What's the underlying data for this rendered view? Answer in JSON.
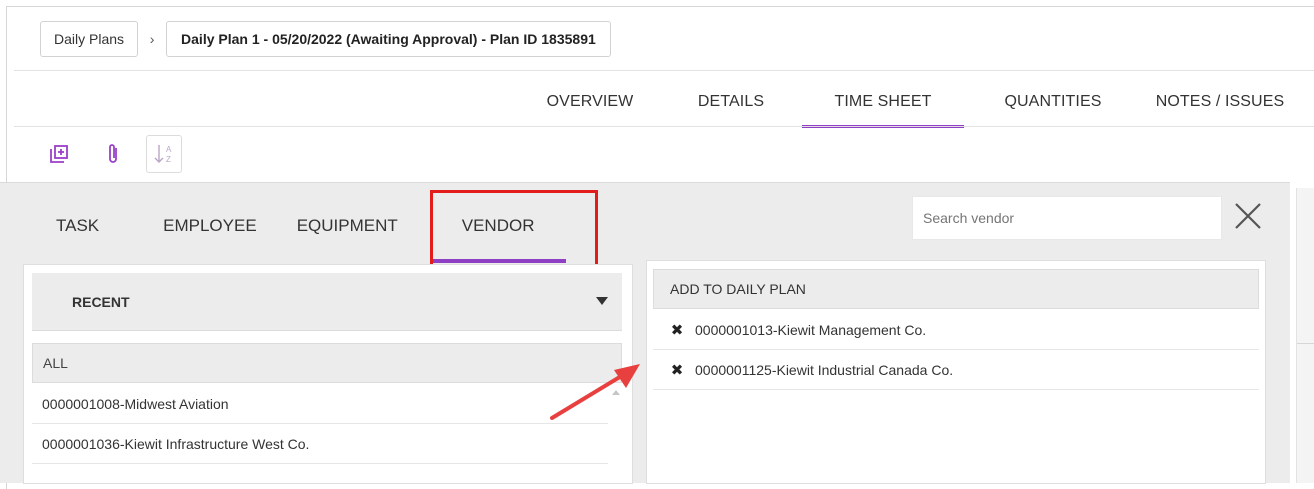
{
  "breadcrumb": {
    "root": "Daily Plans",
    "separator": "›",
    "current": "Daily Plan 1 - 05/20/2022 (Awaiting Approval) - Plan ID 1835891"
  },
  "top_tabs": [
    {
      "label": "OVERVIEW",
      "active": false
    },
    {
      "label": "DETAILS",
      "active": false
    },
    {
      "label": "TIME SHEET",
      "active": true
    },
    {
      "label": "QUANTITIES",
      "active": false
    },
    {
      "label": "NOTES / ISSUES",
      "active": false
    }
  ],
  "toolbar": {
    "icons": [
      "copy-add-icon",
      "paperclip-icon",
      "sort-az-icon"
    ],
    "accent": "#9b3fc8"
  },
  "resource_tabs": [
    {
      "label": "TASK",
      "active": false
    },
    {
      "label": "EMPLOYEE",
      "active": false
    },
    {
      "label": "EQUIPMENT",
      "active": false
    },
    {
      "label": "VENDOR",
      "active": true
    }
  ],
  "search": {
    "placeholder": "Search vendor"
  },
  "left_list": {
    "recent_label": "RECENT",
    "all_label": "ALL",
    "items": [
      "0000001008-Midwest Aviation",
      "0000001036-Kiewit Infrastructure West Co."
    ]
  },
  "right_list": {
    "header": "ADD TO DAILY PLAN",
    "items": [
      "0000001013-Kiewit Management Co.",
      "0000001125-Kiewit Industrial Canada Co."
    ]
  },
  "colors": {
    "accent": "#8e3fc4",
    "highlight_box": "#e21b1b",
    "arrow": "#e8403f"
  }
}
